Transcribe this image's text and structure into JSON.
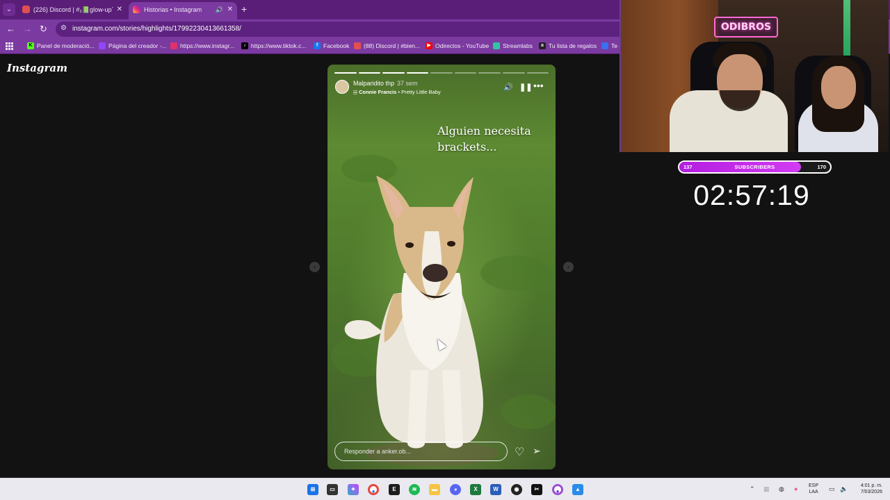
{
  "browser": {
    "tabs": [
      {
        "label": "(226) Discord | #₂📗glow-up´",
        "active": false
      },
      {
        "label": "Historias • Instagram",
        "active": true
      }
    ],
    "url": "instagram.com/stories/highlights/17992230413661358/",
    "bookmarks": [
      "Panel de moderació...",
      "Página del creador -...",
      "https://www.instagr...",
      "https://www.tiktok.c...",
      "Facebook",
      "(88) Discord | #bien...",
      "Odirectos - YouTube",
      "Streamlabs",
      "Tu lista de regalos",
      "Te c"
    ]
  },
  "instagram": {
    "logo": "Instagram",
    "story": {
      "username": "Malparidito thp",
      "time_ago": "37 sem",
      "song_artist": "Connie Francis",
      "song_title": "Pretty Little Baby",
      "song_separator": " • ",
      "caption": "Alguien necesita brackets...",
      "reply_placeholder": "Responder a anker.ob...",
      "progress_segments": 9,
      "progress_done": 4
    }
  },
  "stream_overlay": {
    "neon_sign": "ODIBROS",
    "sub_goal": {
      "current": "137",
      "label": "SUBSCRIBERS",
      "target": "170",
      "fraction": 0.806
    },
    "timer": "02:57:19"
  },
  "taskbar": {
    "language_1": "ESP",
    "language_2": "LAA",
    "time": "4:01 p. m.",
    "date": "7/03/2026"
  },
  "colors": {
    "tab_bar": "#5a1e78",
    "toolbar": "#7b3aa0",
    "page_bg": "#121212",
    "sub_fill": "#c22fe8"
  }
}
